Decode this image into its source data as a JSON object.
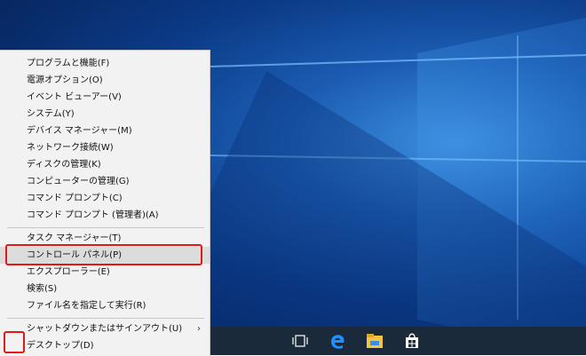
{
  "menu": {
    "items": [
      {
        "label": "プログラムと機能(F)"
      },
      {
        "label": "電源オプション(O)"
      },
      {
        "label": "イベント ビューアー(V)"
      },
      {
        "label": "システム(Y)"
      },
      {
        "label": "デバイス マネージャー(M)"
      },
      {
        "label": "ネットワーク接続(W)"
      },
      {
        "label": "ディスクの管理(K)"
      },
      {
        "label": "コンピューターの管理(G)"
      },
      {
        "label": "コマンド プロンプト(C)"
      },
      {
        "label": "コマンド プロンプト (管理者)(A)"
      },
      {
        "label": "タスク マネージャー(T)"
      },
      {
        "label": "コントロール パネル(P)"
      },
      {
        "label": "エクスプローラー(E)"
      },
      {
        "label": "検索(S)"
      },
      {
        "label": "ファイル名を指定して実行(R)"
      },
      {
        "label": "シャットダウンまたはサインアウト(U)"
      },
      {
        "label": "デスクトップ(D)"
      }
    ],
    "highlighted": "コントロール パネル(P)",
    "submenu_arrow": "›"
  },
  "colors": {
    "desktop": "#0b3a86",
    "taskbar": "#1a2a3a",
    "annotation": "#e01818"
  },
  "taskbar": {
    "icons": [
      "task-view-icon",
      "edge-icon",
      "file-explorer-icon",
      "store-icon"
    ]
  }
}
